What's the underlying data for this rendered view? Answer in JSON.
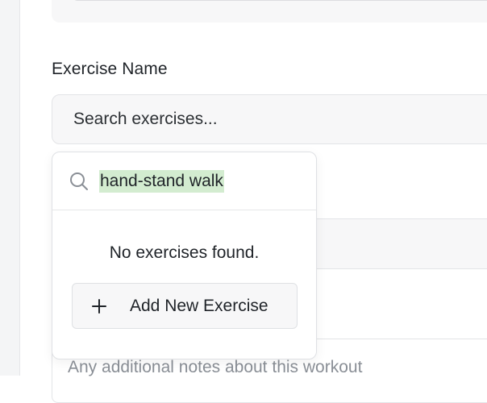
{
  "form": {
    "exercise_name_label": "Exercise Name",
    "exercise_search_placeholder": "Search exercises...",
    "notes_placeholder": "Any additional notes about this workout"
  },
  "popover": {
    "search_value": "hand-stand walk",
    "empty_message": "No exercises found.",
    "add_button_label": "Add New Exercise"
  },
  "icons": {
    "search": "search-icon",
    "add": "plus-icon"
  },
  "colors": {
    "highlight": "#d3ecd0",
    "field_bg": "#f7f7f8",
    "border": "#e3e4e7",
    "placeholder": "#8a8f96"
  }
}
